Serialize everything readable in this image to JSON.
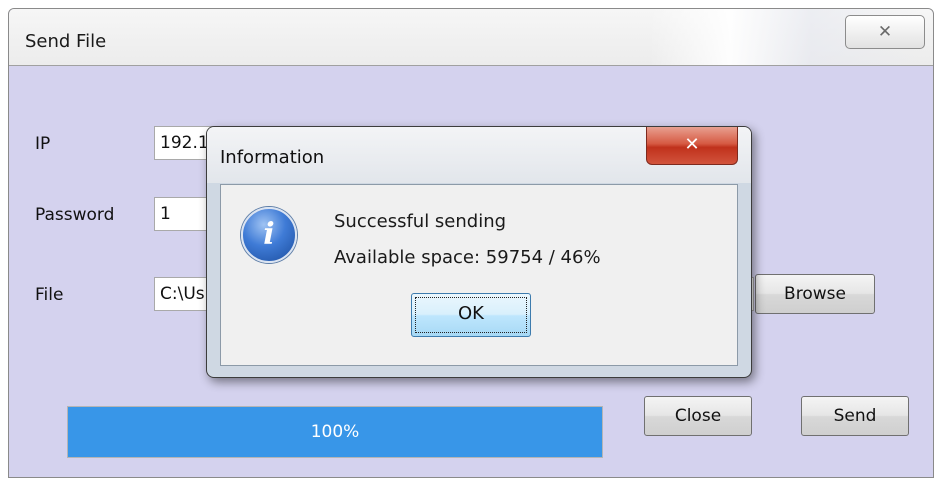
{
  "window": {
    "title": "Send File",
    "close_glyph": "✕",
    "labels": {
      "ip": "IP",
      "password": "Password",
      "file": "File"
    },
    "fields": {
      "ip_value": "192.1",
      "password_value": "1",
      "file_value": "C:\\Us"
    },
    "buttons": {
      "browse": "Browse",
      "close": "Close",
      "send": "Send"
    },
    "progress": {
      "value": 1.0,
      "text": "100%",
      "color": "#3896e8"
    }
  },
  "dialog": {
    "title": "Information",
    "close_glyph": "✕",
    "icon": "info-icon",
    "icon_glyph": "i",
    "message_line1": "Successful sending",
    "message_line2": "Available space: 59754 / 46%",
    "ok_label": "OK"
  }
}
